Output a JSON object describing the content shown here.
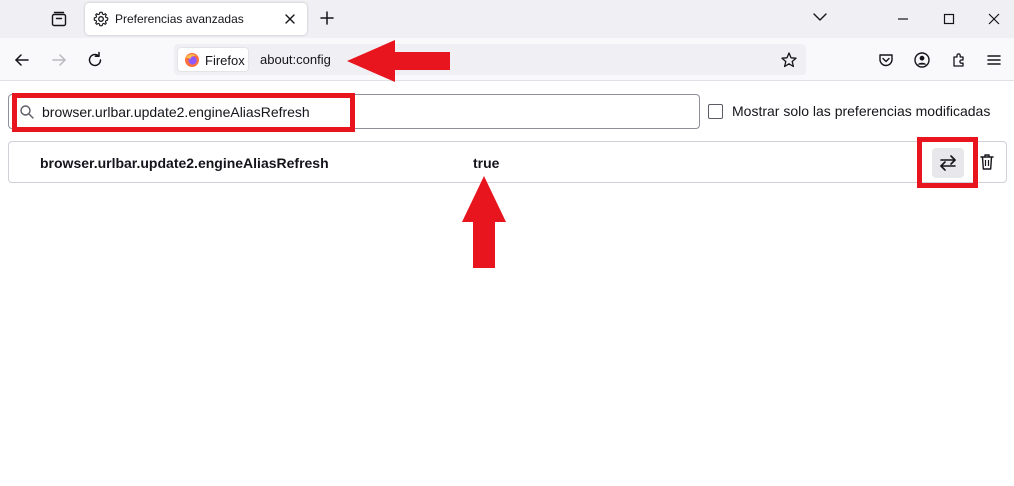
{
  "tab": {
    "title": "Preferencias avanzadas",
    "icon": "gear-icon"
  },
  "urlbar": {
    "identity_label": "Firefox",
    "url": "about:config"
  },
  "search": {
    "value": "browser.urlbar.update2.engineAliasRefresh"
  },
  "filter": {
    "label": "Mostrar solo las preferencias modificadas",
    "checked": false
  },
  "preference": {
    "name": "browser.urlbar.update2.engineAliasRefresh",
    "value": "true"
  },
  "annotations": {
    "color": "#e8141e"
  },
  "colors": {
    "firefox_orange": "#ff7139",
    "firefox_purple": "#9059ff"
  }
}
